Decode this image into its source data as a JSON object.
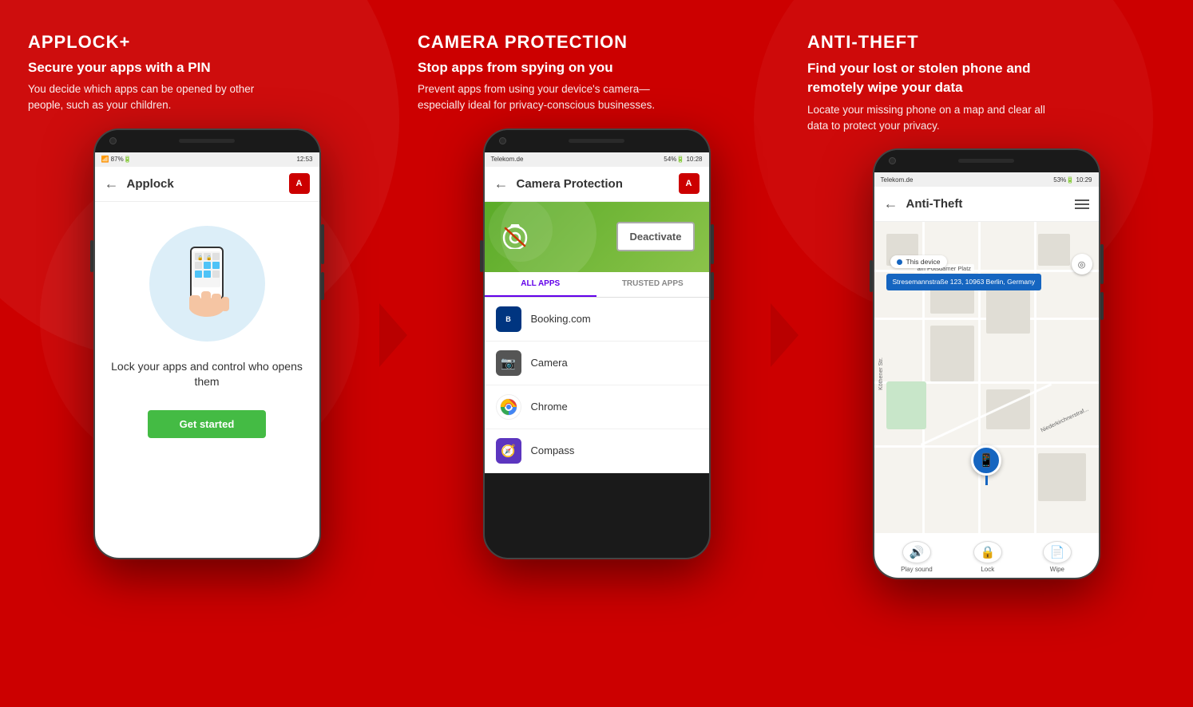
{
  "features": [
    {
      "tag": "APPLOCK+",
      "subtitle": "Secure your apps with a PIN",
      "description": "You decide which apps can be opened by other people, such as your children.",
      "phone": {
        "statusLeft": "87%",
        "statusTime": "12:53",
        "headerTitle": "Applock",
        "mainText": "Lock your apps and control who opens them",
        "ctaLabel": "Get started"
      }
    },
    {
      "tag": "CAMERA PROTECTION",
      "subtitle": "Stop apps from spying on you",
      "description": "Prevent apps from using your device's camera—especially ideal for privacy-conscious businesses.",
      "phone": {
        "statusLeft": "Telekom.de",
        "statusRight": "54%",
        "statusTime": "10:28",
        "headerTitle": "Camera Protection",
        "deactivateLabel": "Deactivate",
        "tab1": "ALL APPS",
        "tab2": "TRUSTED APPS",
        "apps": [
          {
            "name": "Booking.com",
            "icon": "booking"
          },
          {
            "name": "Camera",
            "icon": "camera"
          },
          {
            "name": "Chrome",
            "icon": "chrome"
          },
          {
            "name": "Compass",
            "icon": "compass"
          }
        ]
      }
    },
    {
      "tag": "ANTI-THEFT",
      "subtitle": "Find your lost or stolen phone and remotely wipe your data",
      "description": "Locate your missing phone on a map and clear all data to protect your privacy.",
      "phone": {
        "statusLeft": "Telekom.de",
        "statusRight": "53%",
        "statusTime": "10:29",
        "headerTitle": "Anti-Theft",
        "mapLabel": "This device",
        "address": "Stresemannstraße 123, 10963 Berlin, Germany",
        "action1": "Play sound",
        "action2": "Lock",
        "action3": "Wipe"
      }
    }
  ]
}
